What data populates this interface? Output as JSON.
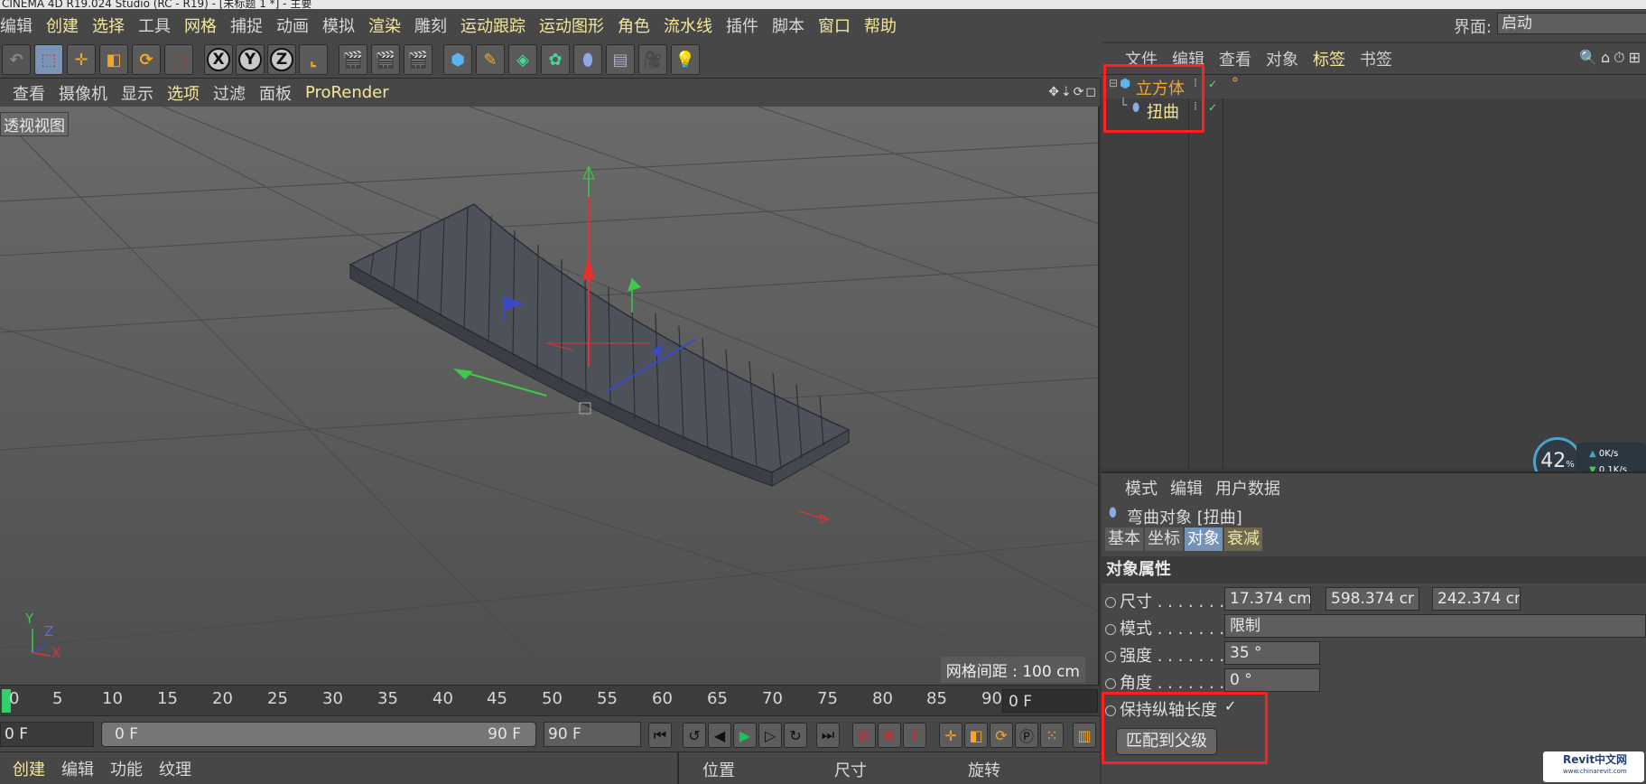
{
  "window": {
    "title": "CINEMA 4D R19.024 Studio (RC - R19) - [未标题 1 *] - 主要"
  },
  "menubar": {
    "items": [
      {
        "label": "编辑",
        "hl": false
      },
      {
        "label": "创建",
        "hl": true
      },
      {
        "label": "选择",
        "hl": true
      },
      {
        "label": "工具",
        "hl": false
      },
      {
        "label": "网格",
        "hl": true
      },
      {
        "label": "捕捉",
        "hl": false
      },
      {
        "label": "动画",
        "hl": false
      },
      {
        "label": "模拟",
        "hl": false
      },
      {
        "label": "渲染",
        "hl": true
      },
      {
        "label": "雕刻",
        "hl": false
      },
      {
        "label": "运动跟踪",
        "hl": true
      },
      {
        "label": "运动图形",
        "hl": true
      },
      {
        "label": "角色",
        "hl": true
      },
      {
        "label": "流水线",
        "hl": true
      },
      {
        "label": "插件",
        "hl": false
      },
      {
        "label": "脚本",
        "hl": false
      },
      {
        "label": "窗口",
        "hl": true
      },
      {
        "label": "帮助",
        "hl": true
      }
    ],
    "layout_label": "界面:",
    "layout_value": "启动"
  },
  "toolbar": {
    "x": "X",
    "y": "Y",
    "z": "Z"
  },
  "viewport_menu": {
    "items": [
      {
        "label": "查看",
        "hl": false
      },
      {
        "label": "摄像机",
        "hl": false
      },
      {
        "label": "显示",
        "hl": false
      },
      {
        "label": "选项",
        "hl": true
      },
      {
        "label": "过滤",
        "hl": false
      },
      {
        "label": "面板",
        "hl": false
      },
      {
        "label": "ProRender",
        "hl": true
      }
    ],
    "icons": "✥⇣⟳◻"
  },
  "viewport": {
    "label": "透视视图",
    "grid_spacing": "网格间距 : 100 cm",
    "axis_y": "Y",
    "axis_z": "Z",
    "axis_x": "X"
  },
  "timeline": {
    "ticks": [
      "0",
      "5",
      "10",
      "15",
      "20",
      "25",
      "30",
      "35",
      "40",
      "45",
      "50",
      "55",
      "60",
      "65",
      "70",
      "75",
      "80",
      "85",
      "90"
    ],
    "current_frame": "0 F"
  },
  "transport": {
    "start_field": "0 F",
    "range_start": "0 F",
    "range_end": "90 F",
    "end_field": "90 F"
  },
  "bottom_menu": {
    "items": [
      {
        "label": "创建",
        "hl": true
      },
      {
        "label": "编辑",
        "hl": false
      },
      {
        "label": "功能",
        "hl": false
      },
      {
        "label": "纹理",
        "hl": false
      }
    ]
  },
  "coord_manager": {
    "position": "位置",
    "size": "尺寸",
    "rotation": "旋转"
  },
  "object_manager": {
    "menu": [
      {
        "label": "文件",
        "hl": false
      },
      {
        "label": "编辑",
        "hl": false
      },
      {
        "label": "查看",
        "hl": false
      },
      {
        "label": "对象",
        "hl": false
      },
      {
        "label": "标签",
        "hl": true
      },
      {
        "label": "书签",
        "hl": false
      }
    ],
    "icons": "🔍⌂⏱⊞",
    "objects": [
      {
        "name": "立方体",
        "color": "#f0a43a"
      },
      {
        "name": "扭曲",
        "color": "#f5e79a"
      }
    ]
  },
  "perf": {
    "percent": "42",
    "unit": "%",
    "up": "0K/s",
    "down": "0.1K/s"
  },
  "attribute_manager": {
    "menu": [
      "模式",
      "编辑",
      "用户数据"
    ],
    "object_title": "弯曲对象 [扭曲]",
    "tabs": [
      {
        "label": "基本",
        "state": "normal"
      },
      {
        "label": "坐标",
        "state": "normal"
      },
      {
        "label": "对象",
        "state": "active"
      },
      {
        "label": "衰减",
        "state": "fall"
      }
    ],
    "section": "对象属性",
    "props": {
      "size_label": "尺寸 . . . . . . . . . . . .",
      "size_x": "17.374 cm",
      "size_y": "598.374 cr",
      "size_z": "242.374 cr",
      "mode_label": "模式 . . . . . . . . . . . .",
      "mode_value": "限制",
      "strength_label": "强度 . . . . . . . . . . . .",
      "strength_value": "35 °",
      "angle_label": "角度 . . . . . . . . . . . .",
      "angle_value": "0 °",
      "keep_length_label": "保持纵轴长度",
      "keep_length_check": "✓",
      "match_parent": "匹配到父级"
    }
  },
  "watermark": {
    "line1": "Revit中文网",
    "line2": "www.chinarevit.com"
  }
}
